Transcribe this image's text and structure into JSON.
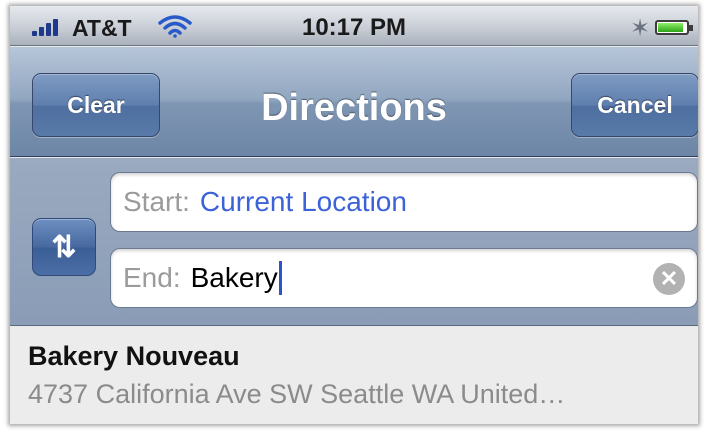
{
  "status_bar": {
    "carrier": "AT&T",
    "time": "10:17 PM",
    "bluetooth_icon": "✶",
    "battery_level": 0.9,
    "signal_bars": 4
  },
  "nav_bar": {
    "clear_label": "Clear",
    "title": "Directions",
    "cancel_label": "Cancel"
  },
  "route": {
    "swap_icon": "⇅",
    "start_label": "Start:",
    "start_value": "Current Location",
    "end_label": "End:",
    "end_value": "Bakery",
    "clear_icon": "✕"
  },
  "results": [
    {
      "name": "Bakery Nouveau",
      "address": "4737 California Ave SW Seattle WA United…"
    }
  ],
  "colors": {
    "nav_blue": "#6d86a6",
    "button_blue": "#587aa9",
    "link_blue": "#3b62d6"
  }
}
